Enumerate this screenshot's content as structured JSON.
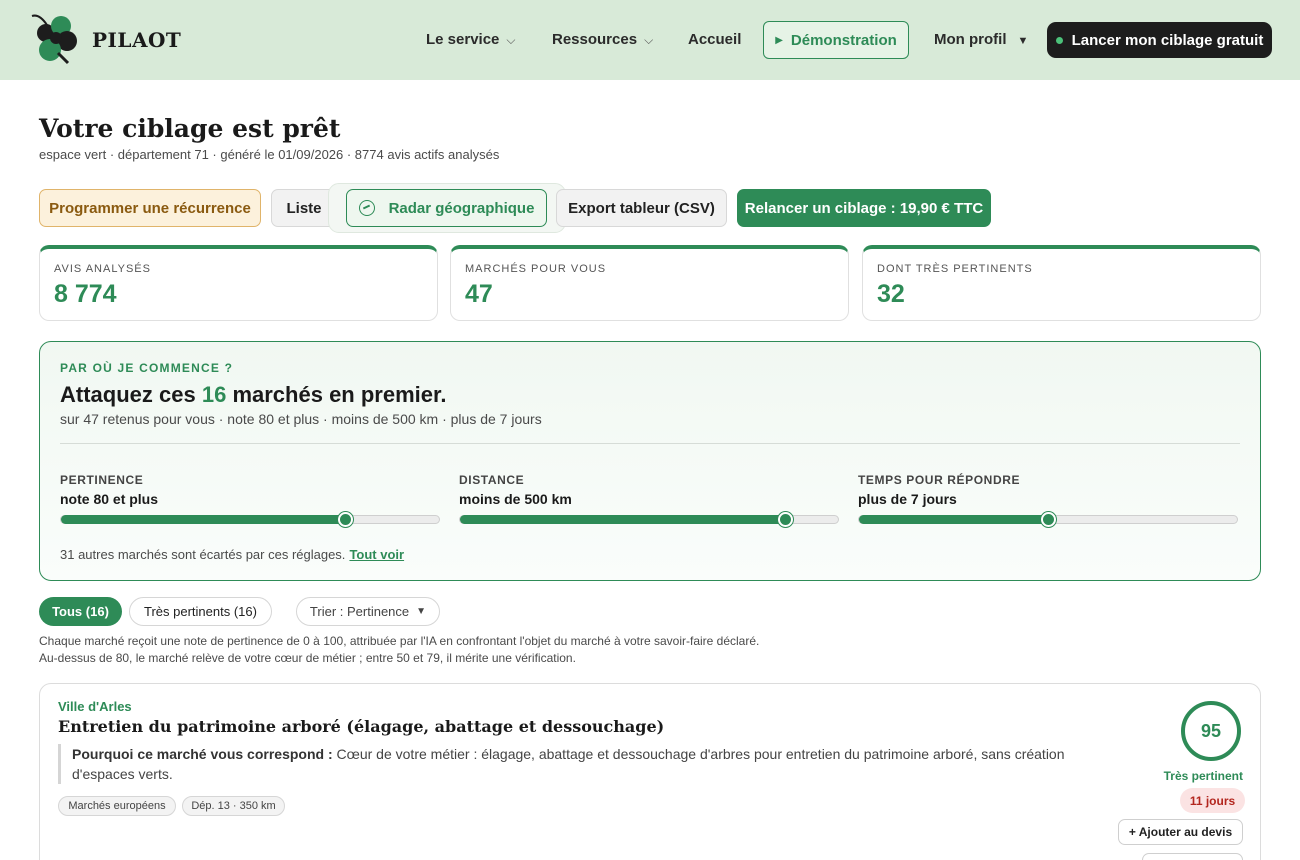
{
  "header": {
    "brand": "PILAOT",
    "nav": {
      "service": "Le service",
      "resources": "Ressources",
      "home": "Accueil",
      "demo": "Démonstration",
      "profile": "Mon profil"
    },
    "cta": "Lancer mon ciblage gratuit"
  },
  "page": {
    "title": "Votre ciblage est prêt",
    "subtitle": "espace vert · département 71 · généré le 01/09/2026 · 8774 avis actifs analysés"
  },
  "actions": {
    "recurrence": "Programmer une récurrence",
    "list": "Liste",
    "radar": "Radar géographique",
    "csv": "Export tableur (CSV)",
    "relaunch": "Relancer un ciblage : 19,90 € TTC"
  },
  "stats": [
    {
      "label": "AVIS ANALYSÉS",
      "value": "8 774"
    },
    {
      "label": "MARCHÉS POUR VOUS",
      "value": "47"
    },
    {
      "label": "DONT TRÈS PERTINENTS",
      "value": "32"
    }
  ],
  "highlight": {
    "kicker": "PAR OÙ JE COMMENCE ?",
    "title_before": "Attaquez ces",
    "title_count": "16",
    "title_after": "marchés en premier.",
    "subtitle": "sur 47 retenus pour vous · note 80 et plus · moins de 500 km · plus de 7 jours",
    "sliders": [
      {
        "label": "PERTINENCE",
        "value": "note 80 et plus",
        "level": 0.75
      },
      {
        "label": "DISTANCE",
        "value": "moins de 500 km",
        "level": 0.86
      },
      {
        "label": "TEMPS POUR RÉPONDRE",
        "value": "plus de 7 jours",
        "level": 0.5
      }
    ],
    "footer": "31 autres marchés sont écartés par ces réglages.",
    "footer_link": "Tout voir"
  },
  "filters": {
    "all": "Tous (16)",
    "very_relevant": "Très pertinents (16)",
    "sort": "Trier : Pertinence"
  },
  "explanation": {
    "line1": "Chaque marché reçoit une note de pertinence de 0 à 100, attribuée par l'IA en confrontant l'objet du marché à votre savoir-faire déclaré.",
    "line2": "Au-dessus de 80, le marché relève de votre cœur de métier ; entre 50 et 79, il mérite une vérification."
  },
  "results": [
    {
      "buyer": "Ville d'Arles",
      "title": "Entretien du patrimoine arboré (élagage, abattage et dessouchage)",
      "why_label": "Pourquoi ce marché vous correspond :",
      "why_text": "Cœur de votre métier : élagage, abattage et dessouchage d'arbres pour entretien du patrimoine arboré, sans création d'espaces verts.",
      "tags": [
        "Marchés européens",
        "Dép. 13 · 350 km"
      ],
      "score": "95",
      "score_label": "Très pertinent",
      "deadline": "11 jours",
      "add_label": "+ Ajouter au devis"
    }
  ],
  "colors": {
    "accent": "#2e8b57",
    "header_bg": "#d8ead8",
    "warning": "#b3261e"
  }
}
